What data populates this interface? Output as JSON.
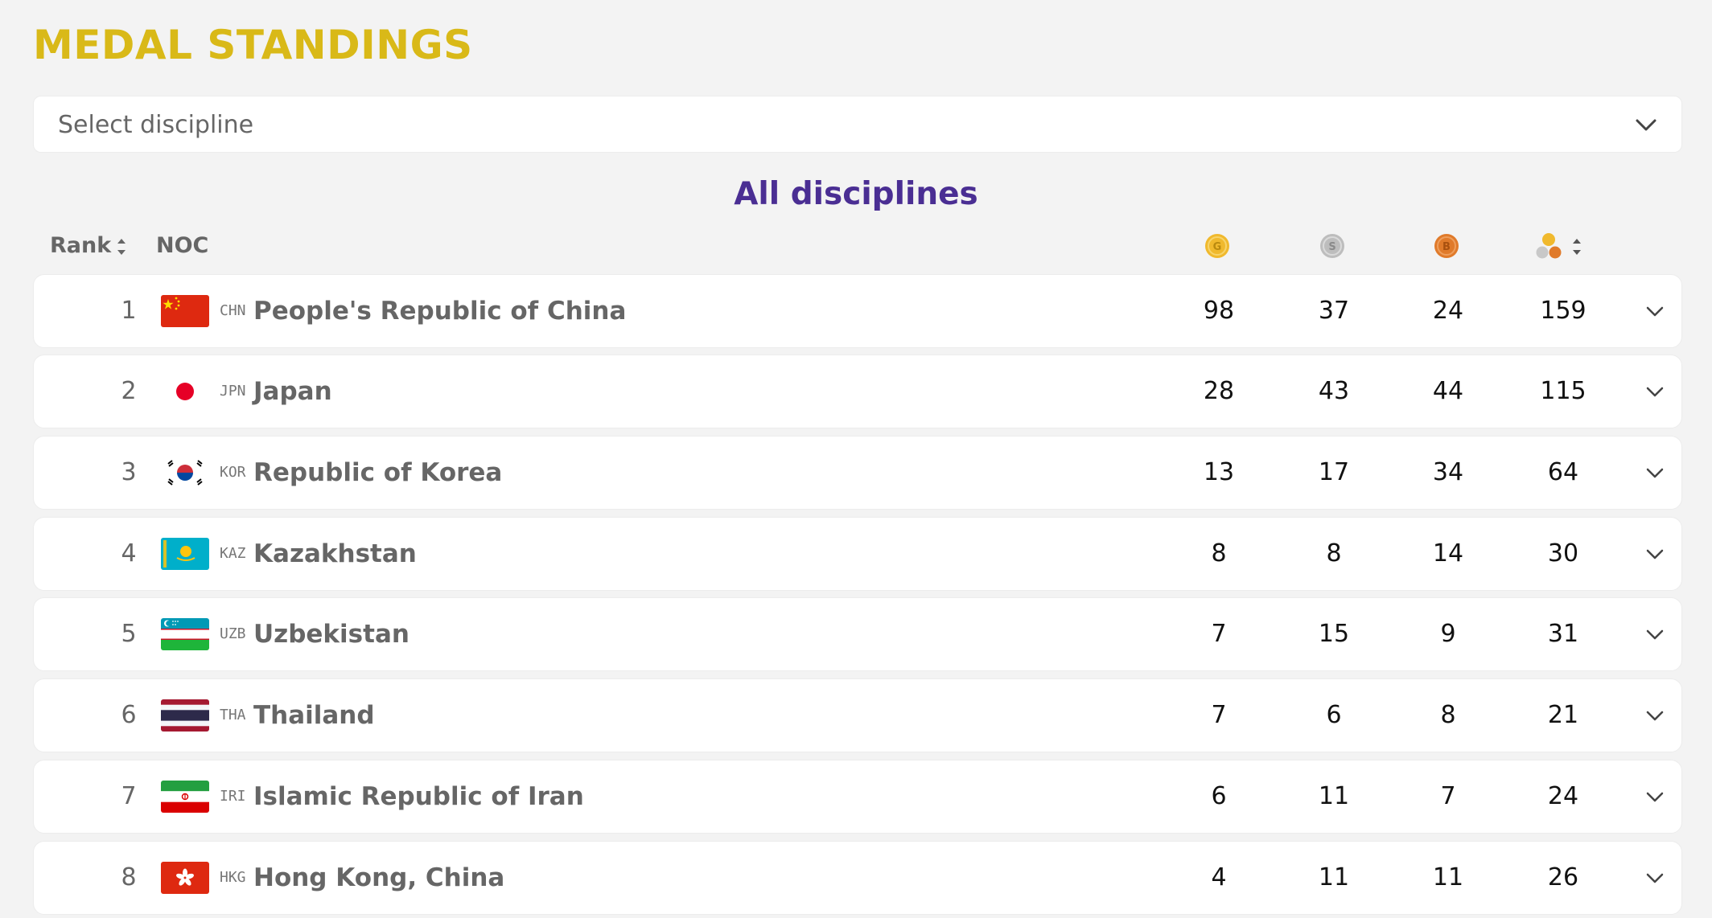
{
  "header": {
    "title": "MEDAL STANDINGS"
  },
  "filter": {
    "placeholder": "Select discipline"
  },
  "subtitle": "All disciplines",
  "columns": {
    "rank": "Rank",
    "noc": "NOC",
    "gold_letter": "G",
    "silver_letter": "S",
    "bronze_letter": "B"
  },
  "colors": {
    "title": "#d9b918",
    "subtitle": "#4a2e93",
    "gold": "#f0b92d",
    "silver": "#bdbdbd",
    "bronze": "#e07a2a"
  },
  "rows": [
    {
      "rank": "1",
      "code": "CHN",
      "country": "People's Republic of China",
      "gold": "98",
      "silver": "37",
      "bronze": "24",
      "total": "159"
    },
    {
      "rank": "2",
      "code": "JPN",
      "country": "Japan",
      "gold": "28",
      "silver": "43",
      "bronze": "44",
      "total": "115"
    },
    {
      "rank": "3",
      "code": "KOR",
      "country": "Republic of Korea",
      "gold": "13",
      "silver": "17",
      "bronze": "34",
      "total": "64"
    },
    {
      "rank": "4",
      "code": "KAZ",
      "country": "Kazakhstan",
      "gold": "8",
      "silver": "8",
      "bronze": "14",
      "total": "30"
    },
    {
      "rank": "5",
      "code": "UZB",
      "country": "Uzbekistan",
      "gold": "7",
      "silver": "15",
      "bronze": "9",
      "total": "31"
    },
    {
      "rank": "6",
      "code": "THA",
      "country": "Thailand",
      "gold": "7",
      "silver": "6",
      "bronze": "8",
      "total": "21"
    },
    {
      "rank": "7",
      "code": "IRI",
      "country": "Islamic Republic of Iran",
      "gold": "6",
      "silver": "11",
      "bronze": "7",
      "total": "24"
    },
    {
      "rank": "8",
      "code": "HKG",
      "country": "Hong Kong, China",
      "gold": "4",
      "silver": "11",
      "bronze": "11",
      "total": "26"
    }
  ]
}
